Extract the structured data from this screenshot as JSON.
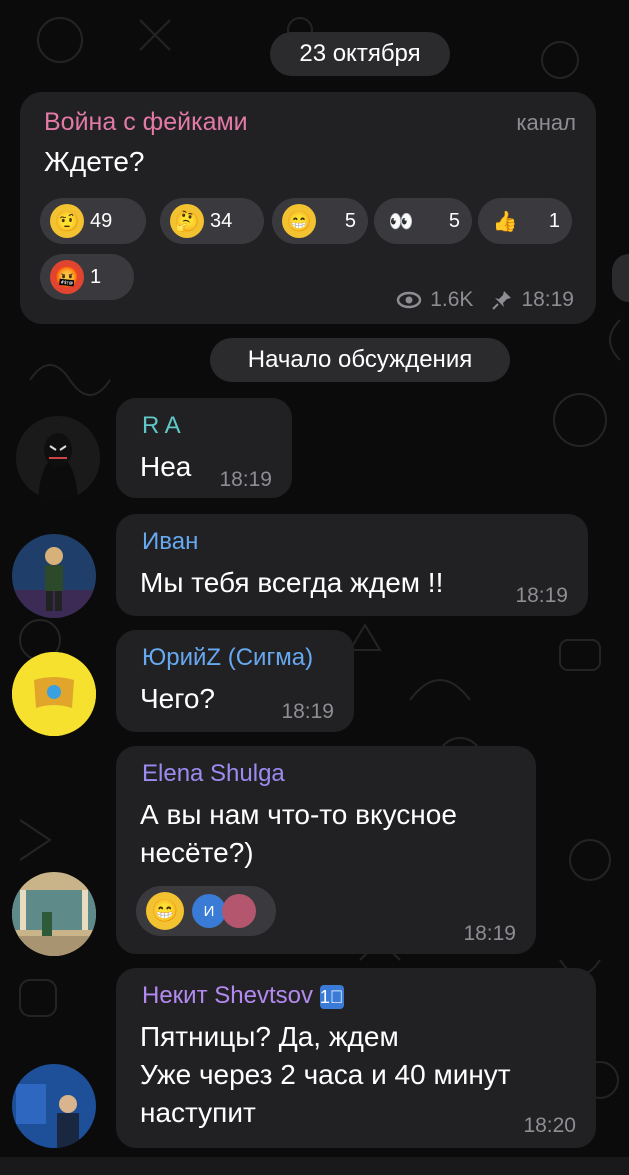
{
  "date_chip": "23 октября",
  "channel_post": {
    "channel_name": "Война с фейками",
    "channel_tag": "канал",
    "text": "Ждете?",
    "reactions": [
      {
        "emoji": "🤨",
        "count": "49"
      },
      {
        "emoji": "🤔",
        "count": "34"
      },
      {
        "emoji": "😁",
        "count": "5"
      },
      {
        "emoji": "👀",
        "count": "5"
      },
      {
        "emoji": "👍",
        "count": "1"
      },
      {
        "emoji": "🤬",
        "count": "1"
      }
    ],
    "views": "1.6K",
    "time": "18:19"
  },
  "section_chip": "Начало обсуждения",
  "messages": [
    {
      "author": "R A",
      "author_color": "#5fc8c8",
      "text": "Нea",
      "time": "18:19"
    },
    {
      "author": "Иван",
      "author_color": "#66a9f0",
      "text": "Мы тебя всегда ждем !!",
      "time": "18:19"
    },
    {
      "author": "ЮрийZ (Сигма)",
      "author_color": "#66a9f0",
      "text": "Чего?",
      "time": "18:19"
    },
    {
      "author": "Elena Shulga",
      "author_color": "#9b8cf0",
      "text_line1": "А вы нам что-то вкусное",
      "text_line2": "несёте?)",
      "reaction_emoji": "😁",
      "reaction_user_initial": "И",
      "time": "18:19"
    },
    {
      "author": "Некит Shevtsov",
      "author_color": "#b48af0",
      "badge": "1⃣",
      "text_line1": "Пятницы? Да, ждем",
      "text_line2": "Уже через 2 часа и 40 минут",
      "text_line3": "наступит",
      "time": "18:20"
    }
  ],
  "colors": {
    "background": "#0b0b0c",
    "bubble": "#212124",
    "chip": "#2b2b2e",
    "meta": "#8d8d92",
    "channel_name": "#e27aa5"
  }
}
